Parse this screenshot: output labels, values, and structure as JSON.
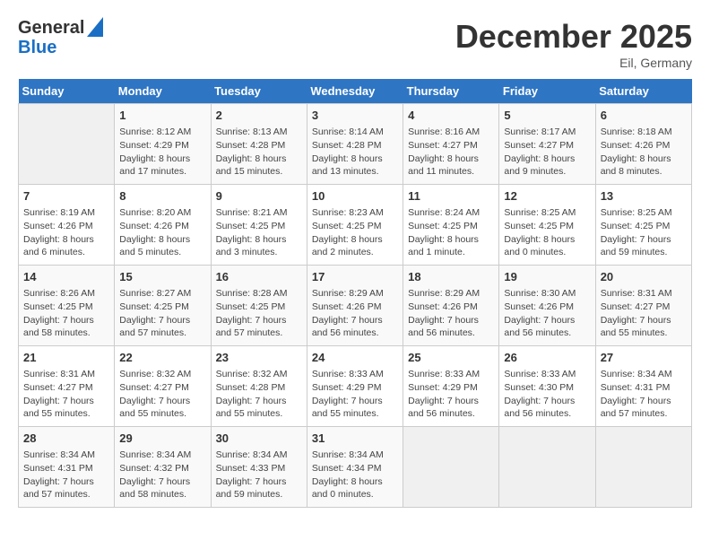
{
  "logo": {
    "line1": "General",
    "line2": "Blue"
  },
  "title": "December 2025",
  "subtitle": "Eil, Germany",
  "days_of_week": [
    "Sunday",
    "Monday",
    "Tuesday",
    "Wednesday",
    "Thursday",
    "Friday",
    "Saturday"
  ],
  "weeks": [
    [
      {
        "day": "",
        "info": ""
      },
      {
        "day": "1",
        "info": "Sunrise: 8:12 AM\nSunset: 4:29 PM\nDaylight: 8 hours\nand 17 minutes."
      },
      {
        "day": "2",
        "info": "Sunrise: 8:13 AM\nSunset: 4:28 PM\nDaylight: 8 hours\nand 15 minutes."
      },
      {
        "day": "3",
        "info": "Sunrise: 8:14 AM\nSunset: 4:28 PM\nDaylight: 8 hours\nand 13 minutes."
      },
      {
        "day": "4",
        "info": "Sunrise: 8:16 AM\nSunset: 4:27 PM\nDaylight: 8 hours\nand 11 minutes."
      },
      {
        "day": "5",
        "info": "Sunrise: 8:17 AM\nSunset: 4:27 PM\nDaylight: 8 hours\nand 9 minutes."
      },
      {
        "day": "6",
        "info": "Sunrise: 8:18 AM\nSunset: 4:26 PM\nDaylight: 8 hours\nand 8 minutes."
      }
    ],
    [
      {
        "day": "7",
        "info": "Sunrise: 8:19 AM\nSunset: 4:26 PM\nDaylight: 8 hours\nand 6 minutes."
      },
      {
        "day": "8",
        "info": "Sunrise: 8:20 AM\nSunset: 4:26 PM\nDaylight: 8 hours\nand 5 minutes."
      },
      {
        "day": "9",
        "info": "Sunrise: 8:21 AM\nSunset: 4:25 PM\nDaylight: 8 hours\nand 3 minutes."
      },
      {
        "day": "10",
        "info": "Sunrise: 8:23 AM\nSunset: 4:25 PM\nDaylight: 8 hours\nand 2 minutes."
      },
      {
        "day": "11",
        "info": "Sunrise: 8:24 AM\nSunset: 4:25 PM\nDaylight: 8 hours\nand 1 minute."
      },
      {
        "day": "12",
        "info": "Sunrise: 8:25 AM\nSunset: 4:25 PM\nDaylight: 8 hours\nand 0 minutes."
      },
      {
        "day": "13",
        "info": "Sunrise: 8:25 AM\nSunset: 4:25 PM\nDaylight: 7 hours\nand 59 minutes."
      }
    ],
    [
      {
        "day": "14",
        "info": "Sunrise: 8:26 AM\nSunset: 4:25 PM\nDaylight: 7 hours\nand 58 minutes."
      },
      {
        "day": "15",
        "info": "Sunrise: 8:27 AM\nSunset: 4:25 PM\nDaylight: 7 hours\nand 57 minutes."
      },
      {
        "day": "16",
        "info": "Sunrise: 8:28 AM\nSunset: 4:25 PM\nDaylight: 7 hours\nand 57 minutes."
      },
      {
        "day": "17",
        "info": "Sunrise: 8:29 AM\nSunset: 4:26 PM\nDaylight: 7 hours\nand 56 minutes."
      },
      {
        "day": "18",
        "info": "Sunrise: 8:29 AM\nSunset: 4:26 PM\nDaylight: 7 hours\nand 56 minutes."
      },
      {
        "day": "19",
        "info": "Sunrise: 8:30 AM\nSunset: 4:26 PM\nDaylight: 7 hours\nand 56 minutes."
      },
      {
        "day": "20",
        "info": "Sunrise: 8:31 AM\nSunset: 4:27 PM\nDaylight: 7 hours\nand 55 minutes."
      }
    ],
    [
      {
        "day": "21",
        "info": "Sunrise: 8:31 AM\nSunset: 4:27 PM\nDaylight: 7 hours\nand 55 minutes."
      },
      {
        "day": "22",
        "info": "Sunrise: 8:32 AM\nSunset: 4:27 PM\nDaylight: 7 hours\nand 55 minutes."
      },
      {
        "day": "23",
        "info": "Sunrise: 8:32 AM\nSunset: 4:28 PM\nDaylight: 7 hours\nand 55 minutes."
      },
      {
        "day": "24",
        "info": "Sunrise: 8:33 AM\nSunset: 4:29 PM\nDaylight: 7 hours\nand 55 minutes."
      },
      {
        "day": "25",
        "info": "Sunrise: 8:33 AM\nSunset: 4:29 PM\nDaylight: 7 hours\nand 56 minutes."
      },
      {
        "day": "26",
        "info": "Sunrise: 8:33 AM\nSunset: 4:30 PM\nDaylight: 7 hours\nand 56 minutes."
      },
      {
        "day": "27",
        "info": "Sunrise: 8:34 AM\nSunset: 4:31 PM\nDaylight: 7 hours\nand 57 minutes."
      }
    ],
    [
      {
        "day": "28",
        "info": "Sunrise: 8:34 AM\nSunset: 4:31 PM\nDaylight: 7 hours\nand 57 minutes."
      },
      {
        "day": "29",
        "info": "Sunrise: 8:34 AM\nSunset: 4:32 PM\nDaylight: 7 hours\nand 58 minutes."
      },
      {
        "day": "30",
        "info": "Sunrise: 8:34 AM\nSunset: 4:33 PM\nDaylight: 7 hours\nand 59 minutes."
      },
      {
        "day": "31",
        "info": "Sunrise: 8:34 AM\nSunset: 4:34 PM\nDaylight: 8 hours\nand 0 minutes."
      },
      {
        "day": "",
        "info": ""
      },
      {
        "day": "",
        "info": ""
      },
      {
        "day": "",
        "info": ""
      }
    ]
  ]
}
